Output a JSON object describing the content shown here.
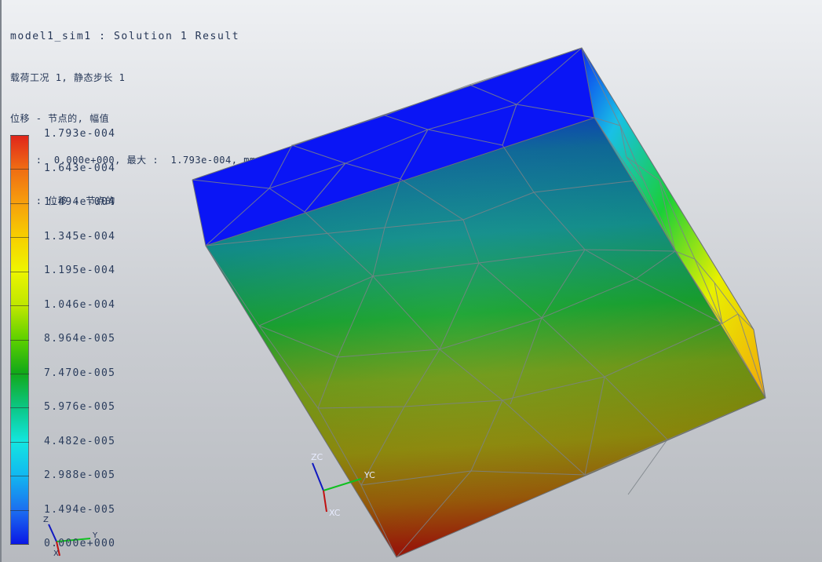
{
  "header": {
    "title": "model1_sim1 : Solution 1 Result",
    "load_case": "载荷工况 1, 静态步长 1",
    "result_type": "位移 - 节点的, 幅值",
    "min_max": "最小 :  0.000e+000, 最大 :  1.793e-004, mm",
    "deformation": "变形 : 位移 - 节点的"
  },
  "legend": {
    "labels": [
      "1.793e-004",
      "1.643e-004",
      "1.494e-004",
      "1.345e-004",
      "1.195e-004",
      "1.046e-004",
      "8.964e-005",
      "7.470e-005",
      "5.976e-005",
      "4.482e-005",
      "2.988e-005",
      "1.494e-005",
      "0.000e+000"
    ]
  },
  "wcs_triad": {
    "z_label": "ZC",
    "y_label": "YC",
    "x_label": "XC"
  },
  "view_triad": {
    "z_label": "Z",
    "y_label": "Y",
    "x_label": "X"
  },
  "colors": {
    "contour_max": "#e0261a",
    "contour_min": "#0a18e6",
    "mesh_lines": "#7c8288"
  }
}
